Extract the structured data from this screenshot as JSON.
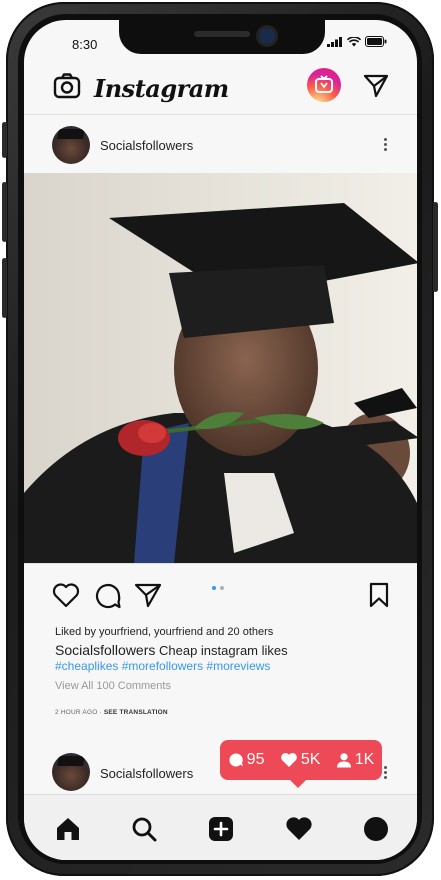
{
  "status_bar": {
    "time": "8:30"
  },
  "header": {
    "app_name": "Instagram"
  },
  "post": {
    "username": "Socialsfollowers",
    "likes_text": "Liked by yourfriend, yourfriend and 20 others",
    "caption_user": "Socialsfollowers",
    "caption_text": "Cheap instagram likes",
    "hashtags": "#cheaplikes #morefollowers #moreviews",
    "comments_link": "View All 100 Comments",
    "time_ago": "2 HOUR AGO",
    "translate_link": "SEE TRANSLATION"
  },
  "next_post": {
    "username": "Socialsfollowers"
  },
  "notification": {
    "comments": "95",
    "likes": "5K",
    "followers": "1K"
  },
  "colors": {
    "accent": "#ed4956",
    "hashtag": "#3897f0"
  },
  "icons": {
    "header": [
      "camera-icon",
      "igtv-icon",
      "direct-message-icon"
    ],
    "actions": [
      "heart-icon",
      "comment-icon",
      "share-icon",
      "bookmark-icon"
    ],
    "nav": [
      "home-icon",
      "search-icon",
      "add-post-icon",
      "activity-heart-icon",
      "profile-icon"
    ]
  }
}
